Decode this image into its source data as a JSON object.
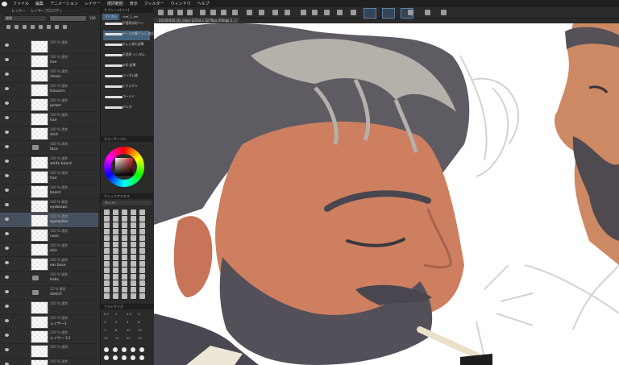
{
  "menu": [
    "ファイル",
    "編集",
    "アニメーション",
    "レイヤー",
    "選択範囲",
    "表示",
    "フィルター",
    "ウィンドウ",
    "ヘルプ"
  ],
  "layer_panel": {
    "tabs": [
      "レイヤー",
      "レイヤープロパティ"
    ],
    "blend_mode": "通常",
    "opacity": "100",
    "layers": [
      {
        "blend": "100 % 通常",
        "name": "",
        "selected": false,
        "folder": false
      },
      {
        "blend": "100 % 通常",
        "name": "line",
        "selected": false,
        "folder": false
      },
      {
        "blend": "100 % 通常",
        "name": "shoes",
        "selected": false,
        "folder": false
      },
      {
        "blend": "100 % 通常",
        "name": "trousers",
        "selected": false,
        "folder": false
      },
      {
        "blend": "100 % 通常",
        "name": "jacket",
        "selected": false,
        "folder": false
      },
      {
        "blend": "100 % 通常",
        "name": "hair",
        "selected": false,
        "folder": false
      },
      {
        "blend": "100 % 通常",
        "name": "shirt",
        "selected": false,
        "folder": false
      },
      {
        "blend": "100 % 通常",
        "name": "face",
        "selected": false,
        "folder": true
      },
      {
        "blend": "100 % 通常",
        "name": "white beard",
        "selected": false,
        "folder": false
      },
      {
        "blend": "100 % 通常",
        "name": "hair",
        "selected": false,
        "folder": false
      },
      {
        "blend": "100 % 通常",
        "name": "beard",
        "selected": false,
        "folder": false
      },
      {
        "blend": "100 % 通常",
        "name": "eyebrows",
        "selected": false,
        "folder": false
      },
      {
        "blend": "100 % 通常",
        "name": "eyelashes",
        "selected": true,
        "folder": false
      },
      {
        "blend": "100 % 通常",
        "name": "nose",
        "selected": false,
        "folder": false
      },
      {
        "blend": "100 % 通常",
        "name": "skin",
        "selected": false,
        "folder": false
      },
      {
        "blend": "100 % 通常",
        "name": "ear base",
        "selected": false,
        "folder": false
      },
      {
        "blend": "100 % 通常",
        "name": "bobs",
        "selected": false,
        "folder": true
      },
      {
        "blend": "25 % 通常",
        "name": "sketch",
        "selected": false,
        "folder": true
      },
      {
        "blend": "100 % 通常",
        "name": "",
        "selected": false,
        "folder": false
      },
      {
        "blend": "100 % 通常",
        "name": "レイヤー1",
        "selected": false,
        "folder": false
      },
      {
        "blend": "100 % 通常",
        "name": "レイヤー 13",
        "selected": false,
        "folder": false
      },
      {
        "blend": "100 % 通常",
        "name": "",
        "selected": false,
        "folder": false
      },
      {
        "blend": "100 % 通常",
        "name": "レイヤー 2",
        "selected": false,
        "folder": false
      }
    ]
  },
  "sub_tool_panel": {
    "title": "サブツール[ペン]",
    "tabs": [
      "マジカル",
      "ctef_1_ink"
    ],
    "brushes": [
      {
        "label": "不透明水彩ペン",
        "selected": false
      },
      {
        "label": "ベースの筆ブラシ_無回転",
        "selected": true
      },
      {
        "label": "ちょい掠れ鉛筆",
        "selected": false
      },
      {
        "label": "不透明 ランダム",
        "selected": false
      },
      {
        "label": "水彩 鉛筆",
        "selected": false
      },
      {
        "label": "ランダム線",
        "selected": false
      },
      {
        "label": "テクスチャ",
        "selected": false
      },
      {
        "label": "ゴールド",
        "selected": false
      },
      {
        "label": "ボルダ",
        "selected": false
      }
    ]
  },
  "color_panel": {
    "title": "カラーサークル",
    "hue_color": "#c61f1f"
  },
  "quick_access": {
    "title": "クイックアクセス",
    "set": "セット1"
  },
  "brush_size": {
    "title": "ブラシサイズ",
    "sizes": [
      "0.7",
      "1",
      "1.5",
      "2",
      "3",
      "4",
      "5",
      "6",
      "7",
      "8",
      "10",
      "12",
      "15",
      "17",
      "20",
      "25"
    ]
  },
  "document": {
    "tab_title": "20240416_01_color (2334 x 3279px 350dpi 2...)"
  },
  "colors": {
    "bg": "#2b2b2b",
    "accent": "#5e7fa3",
    "skin": "#cd7f60",
    "hair": "#5e5b63",
    "hair_light": "#b6b0ab"
  }
}
